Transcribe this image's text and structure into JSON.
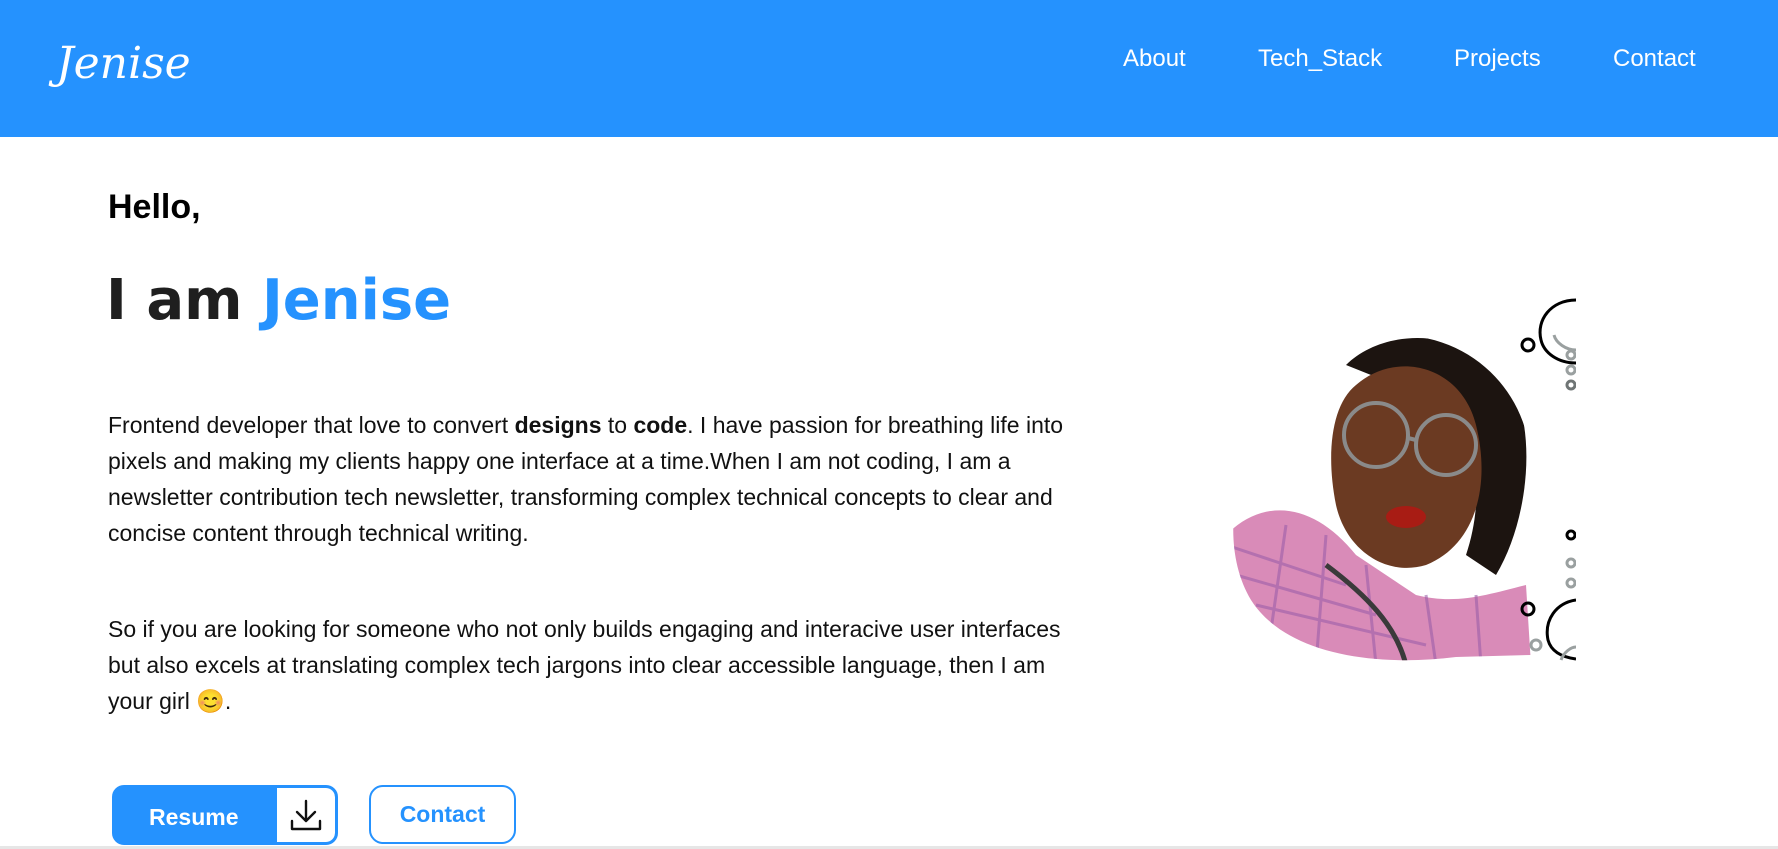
{
  "navbar": {
    "logo": "Jenise",
    "links": [
      "About",
      "Tech_Stack",
      "Projects",
      "Contact"
    ]
  },
  "hero": {
    "greeting": "Hello,",
    "intro_prefix": "I am ",
    "name": "Jenise",
    "para1": {
      "t1": "Frontend developer that love to convert ",
      "b1": "designs",
      "t2": " to ",
      "b2": "code",
      "t3": ". I have passion for breathing life into pixels and making my clients happy one interface at a time.When I am not coding, I am a newsletter contribution tech newsletter, transforming complex technical concepts to clear and concise content through technical writing."
    },
    "para2": {
      "text": "So if you are looking for someone who not only builds engaging and interacive user interfaces but also excels at translating complex tech jargons into clear accessible language, then I am your girl ",
      "emoji": "😊",
      "end": "."
    }
  },
  "buttons": {
    "resume": "Resume",
    "contact": "Contact"
  },
  "colors": {
    "accent": "#2592fe",
    "text": "#111111"
  },
  "icons": {
    "download": "download-icon"
  }
}
